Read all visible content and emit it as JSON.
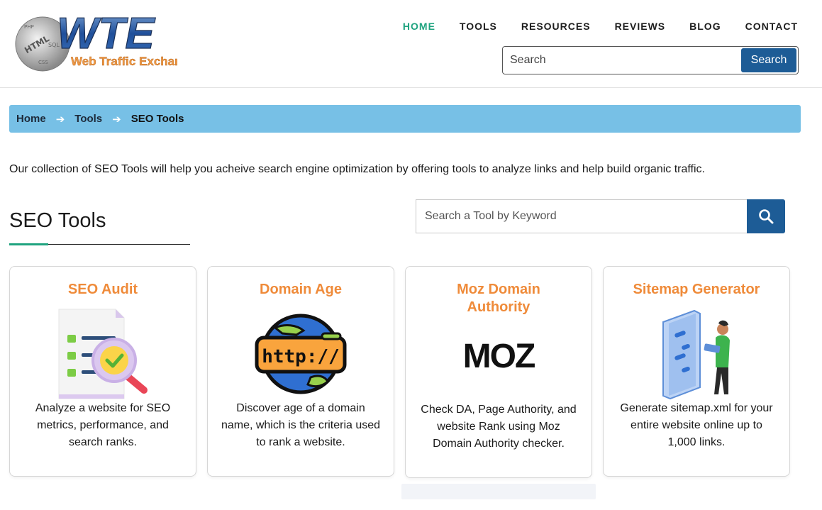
{
  "header": {
    "logo": {
      "big_text": "WTE",
      "sub_text": "Web Traffic Exchange",
      "globe_words": [
        "PHP",
        "HTML",
        "SQL",
        "CSS"
      ]
    },
    "nav": [
      {
        "label": "HOME",
        "active": true
      },
      {
        "label": "TOOLS",
        "active": false
      },
      {
        "label": "RESOURCES",
        "active": false
      },
      {
        "label": "REVIEWS",
        "active": false
      },
      {
        "label": "BLOG",
        "active": false
      },
      {
        "label": "CONTACT",
        "active": false
      }
    ],
    "search": {
      "placeholder": "Search",
      "button_label": "Search"
    }
  },
  "breadcrumb": {
    "items": [
      "Home",
      "Tools",
      "SEO Tools"
    ]
  },
  "intro": "Our collection of SEO Tools will help you acheive search engine optimization by offering tools to analyze links and help build organic traffic.",
  "section": {
    "title": "SEO Tools",
    "tool_search_placeholder": "Search a Tool by Keyword"
  },
  "cards": [
    {
      "title": "SEO Audit",
      "icon": "seo-audit-icon",
      "description": "Analyze a website for SEO metrics, performance, and search ranks."
    },
    {
      "title": "Domain Age",
      "icon": "http-globe-icon",
      "image_text": "http://",
      "description": "Discover age of a domain name, which is the criteria used to rank a website."
    },
    {
      "title": "Moz Domain Authority",
      "icon": "moz-logo",
      "image_text": "MOZ",
      "description": "Check DA, Page Authority, and website Rank using Moz Domain Authority checker."
    },
    {
      "title": "Sitemap Generator",
      "icon": "sitemap-icon",
      "description": "Generate sitemap.xml for your entire website online up to 1,000 links."
    }
  ],
  "colors": {
    "accent_green": "#1fa37f",
    "primary_blue": "#1d5c96",
    "breadcrumb_bg": "#77c0e6",
    "card_title": "#ef8b3a"
  }
}
